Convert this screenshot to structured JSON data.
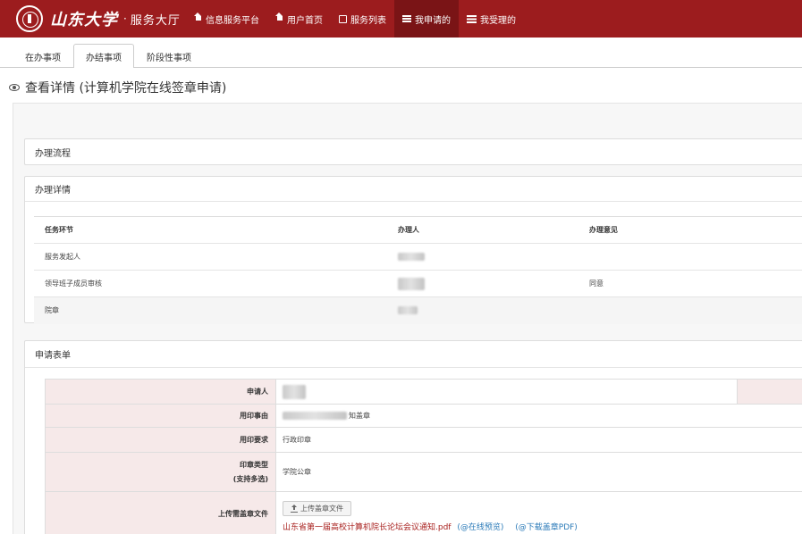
{
  "header": {
    "logo_text": "山东大学",
    "separator": "·",
    "title": "服务大厅",
    "nav": [
      {
        "label": "信息服务平台",
        "icon": "home-icon"
      },
      {
        "label": "用户首页",
        "icon": "home-icon"
      },
      {
        "label": "服务列表",
        "icon": "edit-icon"
      },
      {
        "label": "我申请的",
        "icon": "list-icon",
        "active": true
      },
      {
        "label": "我受理的",
        "icon": "tasks-icon"
      }
    ]
  },
  "tabs": [
    {
      "label": "在办事项"
    },
    {
      "label": "办结事项",
      "active": true
    },
    {
      "label": "阶段性事项"
    }
  ],
  "page": {
    "title": "查看详情 (计算机学院在线签章申请)"
  },
  "process_panel": {
    "heading": "办理流程"
  },
  "detail_panel": {
    "heading": "办理详情",
    "columns": [
      "任务环节",
      "办理人",
      "办理意见"
    ],
    "rows": [
      {
        "step": "服务发起人",
        "opinion": ""
      },
      {
        "step": "领导班子成员审核",
        "opinion": "同意"
      },
      {
        "step": "院章",
        "opinion": ""
      }
    ]
  },
  "form_panel": {
    "heading": "申请表单",
    "applicant_label": "申请人",
    "reason_label": "用印事由",
    "reason_value_suffix": "知盖章",
    "requirement_label": "用印要求",
    "requirement_value": "行政印章",
    "seal_type_label_1": "印章类型",
    "seal_type_label_2": "(支持多选)",
    "seal_type_value": "学院公章",
    "upload_label": "上传需盖章文件",
    "upload_button": "上传盖章文件",
    "file_name": "山东省第一届高校计算机院长论坛会议通知.pdf",
    "preview_link": "(@在线预览)",
    "download_link": "(@下载盖章PDF)"
  },
  "colors": {
    "brand_red": "#9c1c1e",
    "label_pink": "#f6e9e9",
    "link_blue": "#2a7ab8"
  }
}
